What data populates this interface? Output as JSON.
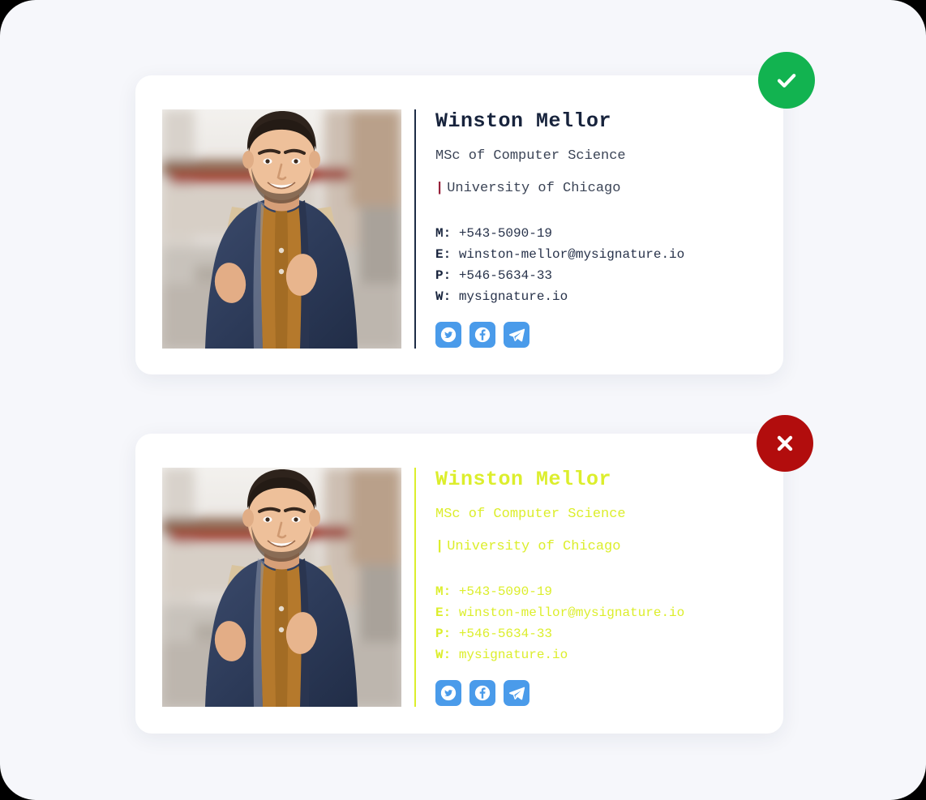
{
  "page": {
    "background_color": "#f6f7fb",
    "card_background": "#ffffff"
  },
  "colors": {
    "accent_navy": "#17233c",
    "accent_yellow": "#dcee2c",
    "social_blue": "#4a9bea",
    "badge_ok_green": "#12b350",
    "badge_bad_red": "#b20d0d",
    "pipe_maroon": "#97213a"
  },
  "cards": [
    {
      "id": "good-signature",
      "status": "approved",
      "status_icon": "check-icon",
      "name": "Winston Mellor",
      "role": "MSc of Computer Science",
      "org_pipe": "|",
      "org": "University of Chicago",
      "contacts": [
        {
          "key": "M:",
          "value": "+543-5090-19"
        },
        {
          "key": "E:",
          "value": "winston-mellor@mysignature.io"
        },
        {
          "key": "P:",
          "value": "+546-5634-33"
        },
        {
          "key": "W:",
          "value": "mysignature.io"
        }
      ],
      "socials": [
        {
          "name": "twitter-icon",
          "label": "Twitter"
        },
        {
          "name": "facebook-icon",
          "label": "Facebook"
        },
        {
          "name": "telegram-icon",
          "label": "Telegram"
        }
      ],
      "photo_alt": "Smiling man in navy jacket with backpack straps on a city street"
    },
    {
      "id": "bad-signature",
      "status": "rejected",
      "status_icon": "close-icon",
      "name": "Winston Mellor",
      "role": "MSc of Computer Science",
      "org_pipe": "|",
      "org": "University of Chicago",
      "contacts": [
        {
          "key": "M:",
          "value": "+543-5090-19"
        },
        {
          "key": "E:",
          "value": "winston-mellor@mysignature.io"
        },
        {
          "key": "P:",
          "value": "+546-5634-33"
        },
        {
          "key": "W:",
          "value": "mysignature.io"
        }
      ],
      "socials": [
        {
          "name": "twitter-icon",
          "label": "Twitter"
        },
        {
          "name": "facebook-icon",
          "label": "Facebook"
        },
        {
          "name": "telegram-icon",
          "label": "Telegram"
        }
      ],
      "photo_alt": "Smiling man in navy jacket with backpack straps on a city street"
    }
  ]
}
